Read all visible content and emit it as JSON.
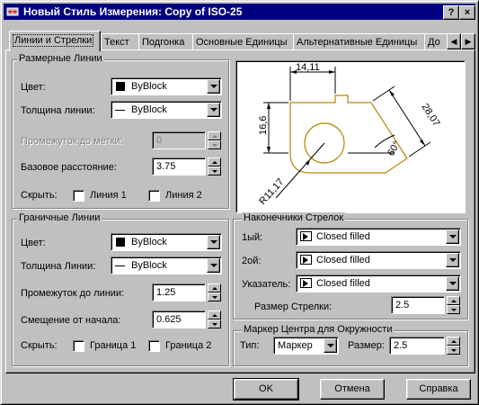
{
  "window": {
    "title": "Новый Стиль Измерения: Copy of ISO-25",
    "help_btn": "?",
    "close_btn": "×"
  },
  "tabs": [
    {
      "label": "Линии и Стрелки",
      "active": true
    },
    {
      "label": "Текст"
    },
    {
      "label": "Подгонка"
    },
    {
      "label": "Основные Единицы"
    },
    {
      "label": "Альтернативные Единицы"
    },
    {
      "label": "До"
    }
  ],
  "dim_lines": {
    "title": "Размерные Линии",
    "color_label": "Цвет:",
    "color_value": "ByBlock",
    "weight_label": "Толщина линии:",
    "weight_value": "ByBlock",
    "extend_label": "Промежуток до метки:",
    "extend_value": "0",
    "baseline_label": "Базовое расстояние:",
    "baseline_value": "3.75",
    "suppress_label": "Скрыть:",
    "line1_label": "Линия 1",
    "line2_label": "Линия 2"
  },
  "ext_lines": {
    "title": "Граничные Линии",
    "color_label": "Цвет:",
    "color_value": "ByBlock",
    "weight_label": "Толщина Линии:",
    "weight_value": "ByBlock",
    "extend_label": "Промежуток до линии:",
    "extend_value": "1.25",
    "offset_label": "Смещение от начала:",
    "offset_value": "0.625",
    "suppress_label": "Скрыть:",
    "ext1_label": "Граница 1",
    "ext2_label": "Граница 2"
  },
  "preview": {
    "dim_top": "14,11",
    "dim_left": "16,6",
    "dim_right": "28,07",
    "dim_angle": "60°",
    "dim_radius": "R11,17"
  },
  "arrowheads": {
    "title": "Наконечники Стрелок",
    "first_label": "1ый:",
    "first_value": "Closed filled",
    "second_label": "2ой:",
    "second_value": "Closed filled",
    "leader_label": "Указатель:",
    "leader_value": "Closed filled",
    "size_label": "Размер Стрелки:",
    "size_value": "2.5"
  },
  "center_marks": {
    "title": "Маркер Центра для Окружности",
    "type_label": "Тип:",
    "type_value": "Маркер",
    "size_label": "Размер:",
    "size_value": "2.5"
  },
  "buttons": {
    "ok": "OK",
    "cancel": "Отмена",
    "help": "Справка"
  },
  "colors": {
    "titlebar": "#000080",
    "face": "#c0c0c0",
    "preview_geometry": "#b8860b"
  }
}
